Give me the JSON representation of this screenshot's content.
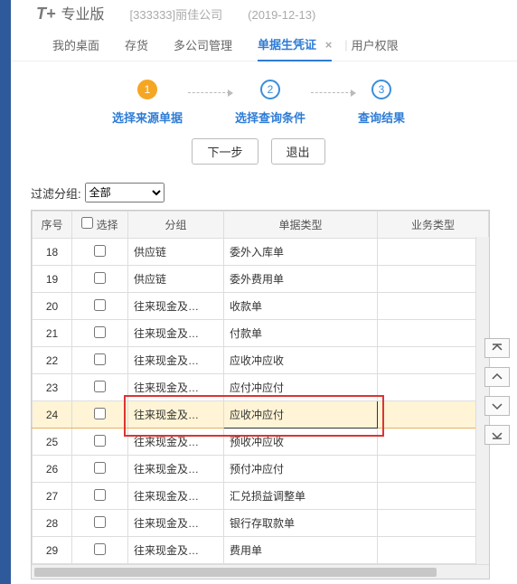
{
  "header": {
    "logo": "T+",
    "edition": "专业版",
    "company": "[333333]丽佳公司",
    "date": "(2019-12-13)"
  },
  "tabs": {
    "items": [
      {
        "label": "我的桌面",
        "active": false
      },
      {
        "label": "存货",
        "active": false
      },
      {
        "label": "多公司管理",
        "active": false
      },
      {
        "label": "单据生凭证",
        "active": true,
        "closable": true
      },
      {
        "label": "用户权限",
        "active": false
      }
    ],
    "close": "×",
    "divider": "|"
  },
  "wizard": {
    "steps": [
      {
        "num": "1",
        "label": "选择来源单据",
        "active": true
      },
      {
        "num": "2",
        "label": "选择查询条件",
        "active": false
      },
      {
        "num": "3",
        "label": "查询结果",
        "active": false
      }
    ],
    "next": "下一步",
    "exit": "退出"
  },
  "filter": {
    "label": "过滤分组:",
    "value": "全部"
  },
  "table": {
    "headers": {
      "no": "序号",
      "select": "选择",
      "group": "分组",
      "type": "单据类型",
      "biz": "业务类型"
    },
    "rows": [
      {
        "no": "18",
        "group": "供应链",
        "type": "委外入库单"
      },
      {
        "no": "19",
        "group": "供应链",
        "type": "委外费用单"
      },
      {
        "no": "20",
        "group": "往来现金及…",
        "type": "收款单"
      },
      {
        "no": "21",
        "group": "往来现金及…",
        "type": "付款单"
      },
      {
        "no": "22",
        "group": "往来现金及…",
        "type": "应收冲应收"
      },
      {
        "no": "23",
        "group": "往来现金及…",
        "type": "应付冲应付"
      },
      {
        "no": "24",
        "group": "往来现金及…",
        "type": "应收冲应付",
        "hl": true
      },
      {
        "no": "25",
        "group": "往来现金及…",
        "type": "预收冲应收"
      },
      {
        "no": "26",
        "group": "往来现金及…",
        "type": "预付冲应付"
      },
      {
        "no": "27",
        "group": "往来现金及…",
        "type": "汇兑损益调整单"
      },
      {
        "no": "28",
        "group": "往来现金及…",
        "type": "银行存取款单"
      },
      {
        "no": "29",
        "group": "往来现金及…",
        "type": "费用单"
      }
    ]
  },
  "icons": {
    "first": "first",
    "prev": "prev",
    "next": "next",
    "last": "last"
  }
}
